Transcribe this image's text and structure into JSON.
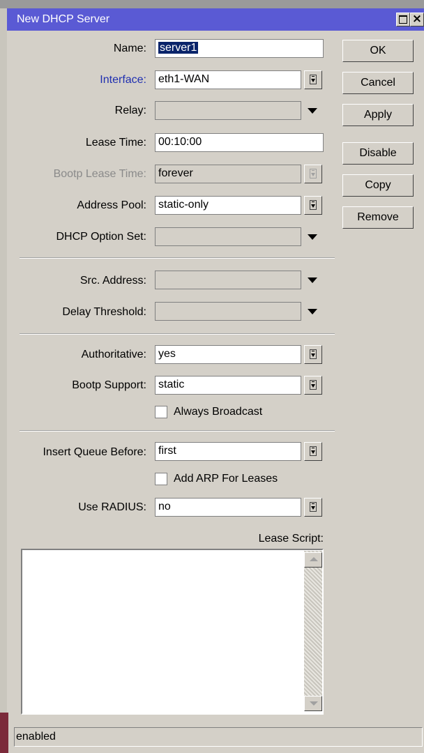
{
  "window": {
    "title": "New DHCP Server"
  },
  "form": {
    "name": {
      "label": "Name:",
      "value": "server1"
    },
    "interface": {
      "label": "Interface:",
      "value": "eth1-WAN"
    },
    "relay": {
      "label": "Relay:",
      "value": ""
    },
    "lease_time": {
      "label": "Lease Time:",
      "value": "00:10:00"
    },
    "bootp_lease_time": {
      "label": "Bootp Lease Time:",
      "value": "forever"
    },
    "address_pool": {
      "label": "Address Pool:",
      "value": "static-only"
    },
    "dhcp_option_set": {
      "label": "DHCP Option Set:",
      "value": ""
    },
    "src_address": {
      "label": "Src. Address:",
      "value": ""
    },
    "delay_threshold": {
      "label": "Delay Threshold:",
      "value": ""
    },
    "authoritative": {
      "label": "Authoritative:",
      "value": "yes"
    },
    "bootp_support": {
      "label": "Bootp Support:",
      "value": "static"
    },
    "always_broadcast": {
      "label": "Always Broadcast",
      "checked": false
    },
    "insert_queue_before": {
      "label": "Insert Queue Before:",
      "value": "first"
    },
    "add_arp": {
      "label": "Add ARP For Leases",
      "checked": false
    },
    "use_radius": {
      "label": "Use RADIUS:",
      "value": "no"
    },
    "lease_script": {
      "label": "Lease Script:",
      "value": ""
    }
  },
  "buttons": {
    "ok": "OK",
    "cancel": "Cancel",
    "apply": "Apply",
    "disable": "Disable",
    "copy": "Copy",
    "remove": "Remove"
  },
  "status": "enabled",
  "colors": {
    "titlebar": "#5a5ad4",
    "window": "#d4d0c8",
    "link_label": "#1f2fb0"
  }
}
